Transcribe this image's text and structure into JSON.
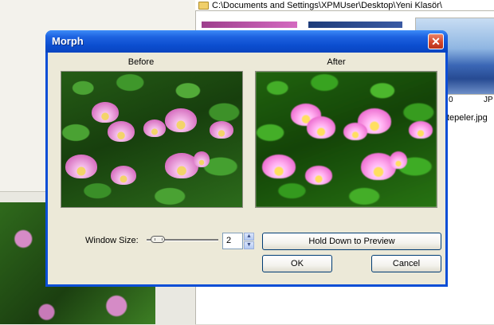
{
  "background": {
    "address_path": "C:\\Documents and Settings\\XPMUser\\Desktop\\Yeni Klasör\\",
    "detail_number": "0",
    "detail_type": "JP",
    "file_name": "tepeler.jpg"
  },
  "dialog": {
    "title": "Morph",
    "close_glyph": "✕",
    "before_label": "Before",
    "after_label": "After",
    "window_size_label": "Window Size:",
    "window_size_value": "2",
    "spin_up_glyph": "▲",
    "spin_down_glyph": "▼",
    "preview_button": "Hold Down to Preview",
    "ok_button": "OK",
    "cancel_button": "Cancel"
  },
  "colors": {
    "title_bar": "#0a4ed6",
    "dialog_face": "#ece9d8",
    "close_button": "#d4452a"
  },
  "icons": {
    "folder": "folder-icon",
    "close": "close-icon",
    "spin_up": "arrow-up-icon",
    "spin_down": "arrow-down-icon"
  }
}
